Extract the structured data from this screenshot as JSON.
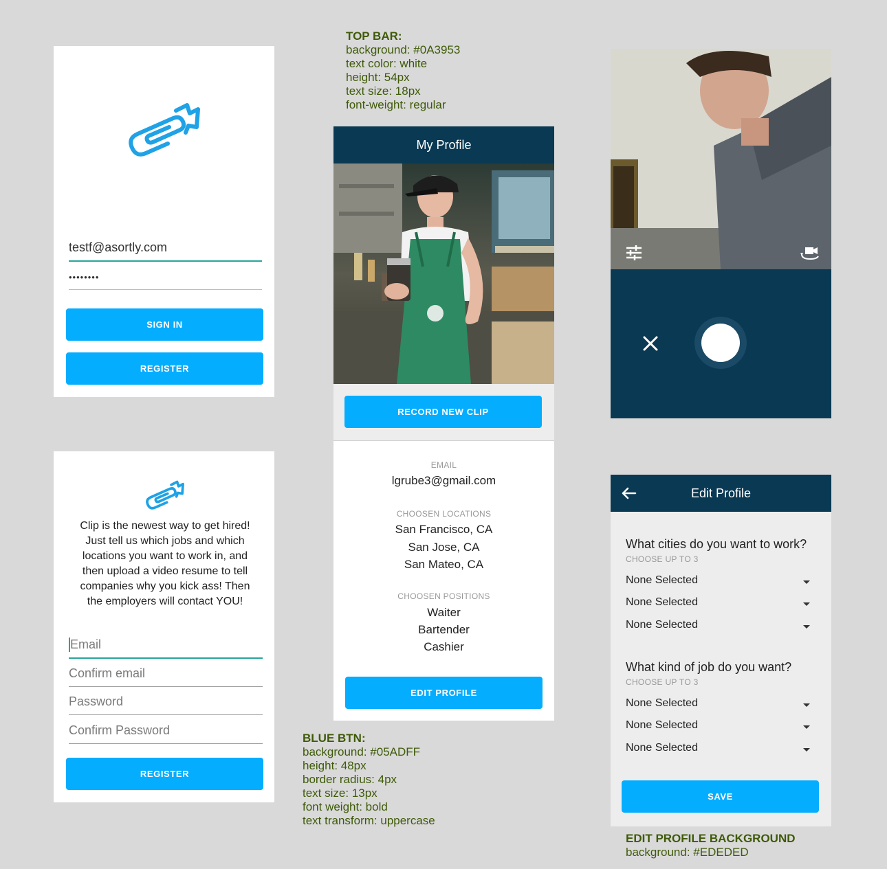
{
  "login": {
    "email_value": "testf@asortly.com",
    "password_value": "••••••••",
    "signin_label": "Sign in",
    "register_label": "Register",
    "logo_icon": "paperclip-camera-icon"
  },
  "register": {
    "intro": "Clip is the newest way to get hired! Just tell us which jobs and which locations you want to work in, and then upload a video resume to tell companies why you kick ass! Then the employers will contact YOU!",
    "email_placeholder": "Email",
    "confirm_email_placeholder": "Confirm email",
    "password_placeholder": "Password",
    "confirm_password_placeholder": "Confirm Password",
    "register_label": "Register"
  },
  "profile": {
    "title": "My Profile",
    "record_label": "Record new clip",
    "email_label": "EMAIL",
    "email_value": "lgrube3@gmail.com",
    "locations_label": "CHOOSEN LOCATIONS",
    "locations": [
      "San Francisco, CA",
      "San Jose, CA",
      "San Mateo, CA"
    ],
    "positions_label": "CHOOSEN POSITIONS",
    "positions": [
      "Waiter",
      "Bartender",
      "Cashier"
    ],
    "edit_label": "Edit profile"
  },
  "camera": {
    "settings_icon": "sliders-icon",
    "switch_icon": "switch-camera-icon",
    "close_icon": "close-icon",
    "shutter_icon": "shutter-button"
  },
  "edit_profile": {
    "title": "Edit Profile",
    "cities_question": "What cities do you want to work?",
    "cities_hint": "CHOOSE UP TO 3",
    "cities": [
      "None Selected",
      "None Selected",
      "None Selected"
    ],
    "jobs_question": "What kind of job do you want?",
    "jobs_hint": "CHOOSE UP TO 3",
    "jobs": [
      "None Selected",
      "None Selected",
      "None Selected"
    ],
    "save_label": "Save"
  },
  "notes": {
    "topbar": {
      "heading": "TOP BAR:",
      "lines": [
        "background: #0A3953",
        "text color: white",
        "height: 54px",
        "text size: 18px",
        "font-weight: regular"
      ]
    },
    "bluebtn": {
      "heading": "BLUE BTN:",
      "lines": [
        "background: #05ADFF",
        "height: 48px",
        "border radius: 4px",
        "text size: 13px",
        "font weight: bold",
        "text transform: uppercase"
      ]
    },
    "editbg": {
      "heading": "EDIT PROFILE BACKGROUND",
      "lines": [
        "background: #EDEDED"
      ]
    }
  },
  "colors": {
    "topbar": "#0A3953",
    "button": "#05ADFF",
    "edit_background": "#EDEDED",
    "note_text": "#3E5A08",
    "focus_underline": "#26A69A"
  }
}
